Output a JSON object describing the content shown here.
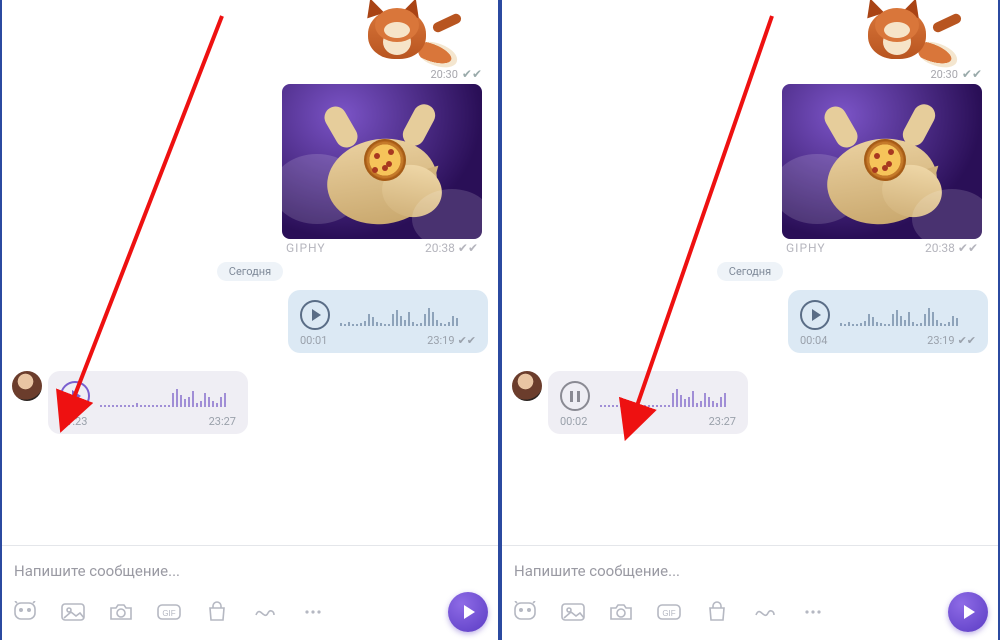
{
  "panes": [
    {
      "sticker_time": "20:30",
      "gif_source": "GIPHY",
      "gif_time": "20:38",
      "day_label": "Сегодня",
      "voice_out": {
        "state": "play",
        "elapsed": "00:01",
        "stamp": "23:19"
      },
      "voice_in": {
        "state": "play",
        "elapsed": "01:23",
        "stamp": "23:27"
      },
      "composer_placeholder": "Напишите сообщение..."
    },
    {
      "sticker_time": "20:30",
      "gif_source": "GIPHY",
      "gif_time": "20:38",
      "day_label": "Сегодня",
      "voice_out": {
        "state": "play",
        "elapsed": "00:04",
        "stamp": "23:19"
      },
      "voice_in": {
        "state": "pause",
        "elapsed": "00:02",
        "stamp": "23:27"
      },
      "composer_placeholder": "Напишите сообщение..."
    }
  ],
  "wave_out": [
    3,
    2,
    4,
    2,
    2,
    3,
    5,
    12,
    9,
    4,
    3,
    2,
    2,
    12,
    16,
    10,
    6,
    14,
    4,
    2,
    3,
    12,
    18,
    14,
    6,
    3,
    2,
    4,
    10,
    8
  ],
  "wave_in": [
    2,
    2,
    2,
    2,
    2,
    2,
    2,
    2,
    2,
    4,
    2,
    2,
    2,
    2,
    2,
    2,
    2,
    2,
    14,
    18,
    12,
    8,
    10,
    16,
    4,
    6,
    14,
    10,
    6,
    4,
    10,
    14
  ]
}
